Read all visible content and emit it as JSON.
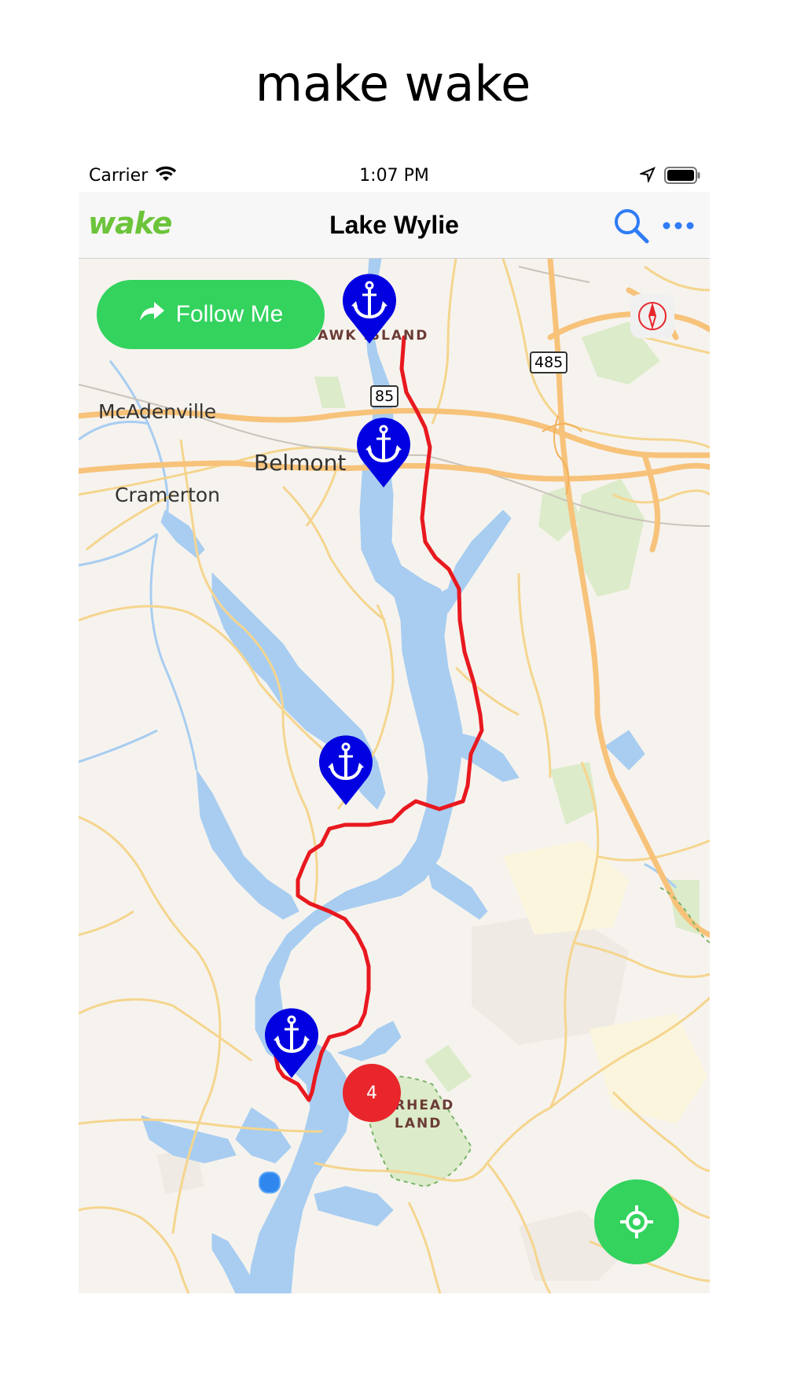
{
  "headline": "make wake",
  "status_bar": {
    "carrier": "Carrier",
    "time": "1:07 PM"
  },
  "nav": {
    "logo": "wake",
    "title": "Lake Wylie"
  },
  "map": {
    "follow_label": "Follow Me",
    "labels": {
      "hawk_island": "HAWK ISLAND",
      "mcadenville": "McAdenville",
      "belmont": "Belmont",
      "cramerton": "Cramerton",
      "rhead_island_line1": "RHEAD",
      "rhead_island_line2": "LAND"
    },
    "shields": {
      "i485": "485",
      "i85": "85"
    },
    "cluster_count": "4",
    "colors": {
      "water": "#a8cdf1",
      "route": "#e8191f",
      "pin": "#0000e0",
      "button": "#33d35e",
      "cluster": "#e8262b"
    }
  }
}
